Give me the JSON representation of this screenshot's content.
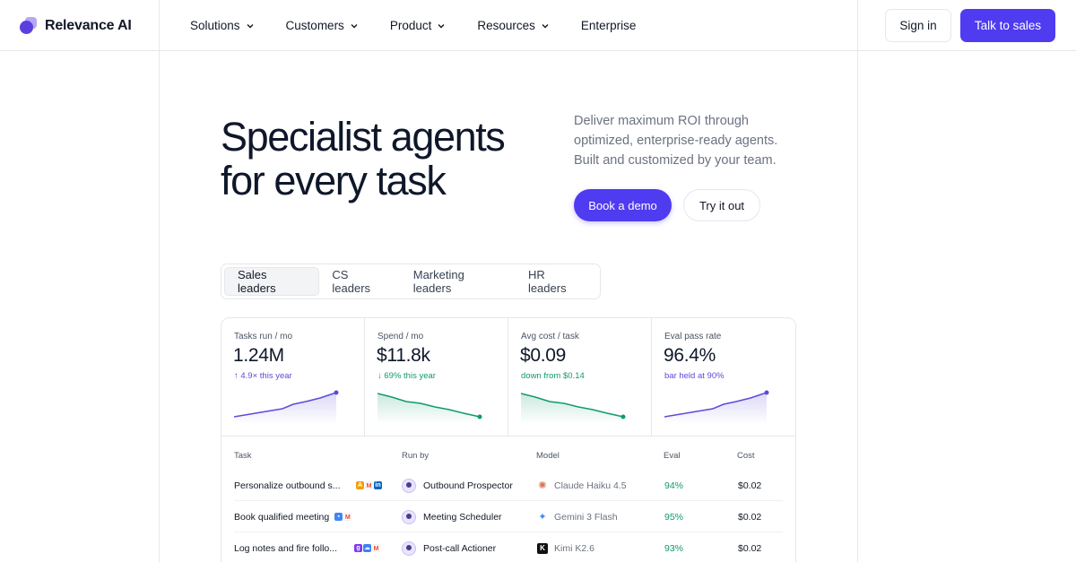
{
  "brand": {
    "name": "Relevance AI"
  },
  "nav": {
    "items": [
      {
        "label": "Solutions",
        "has_menu": true
      },
      {
        "label": "Customers",
        "has_menu": true
      },
      {
        "label": "Product",
        "has_menu": true
      },
      {
        "label": "Resources",
        "has_menu": true
      },
      {
        "label": "Enterprise",
        "has_menu": false
      }
    ],
    "sign_in": "Sign in",
    "talk_to_sales": "Talk to sales"
  },
  "hero": {
    "title_line1": "Specialist agents",
    "title_line2": "for every task",
    "subtitle": "Deliver maximum ROI through optimized, enterprise-ready agents. Built and customized by your team.",
    "book_demo": "Book a demo",
    "try_it": "Try it out"
  },
  "tabs": {
    "items": [
      "Sales leaders",
      "CS leaders",
      "Marketing leaders",
      "HR leaders"
    ],
    "active": "Sales leaders"
  },
  "metrics": [
    {
      "label": "Tasks run / mo",
      "value": "1.24M",
      "delta": "↑ 4.9× this year",
      "trend": "up",
      "color": "#5b4bd8"
    },
    {
      "label": "Spend / mo",
      "value": "$11.8k",
      "delta": "↓ 69% this year",
      "trend": "down",
      "color": "#0f9a6e"
    },
    {
      "label": "Avg cost / task",
      "value": "$0.09",
      "delta": "down from $0.14",
      "trend": "down",
      "color": "#0f9a6e"
    },
    {
      "label": "Eval pass rate",
      "value": "96.4%",
      "delta": "bar held at 90%",
      "trend": "up",
      "color": "#5b4bd8"
    }
  ],
  "table": {
    "headers": {
      "task": "Task",
      "run_by": "Run by",
      "model": "Model",
      "eval": "Eval",
      "cost": "Cost"
    },
    "rows": [
      {
        "task": "Personalize outbound s...",
        "run_by": "Outbound Prospector",
        "model": "Claude Haiku 4.5",
        "model_icon": "claude-icon",
        "eval": "94%",
        "cost": "$0.02"
      },
      {
        "task": "Book qualified meeting",
        "run_by": "Meeting Scheduler",
        "model": "Gemini 3 Flash",
        "model_icon": "gemini-icon",
        "eval": "95%",
        "cost": "$0.02"
      },
      {
        "task": "Log notes and fire follo...",
        "run_by": "Post-call Actioner",
        "model": "Kimi K2.6",
        "model_icon": "kimi-icon",
        "eval": "93%",
        "cost": "$0.02"
      }
    ]
  },
  "colors": {
    "accent": "#4f3bf0",
    "positive": "#0f9a6e",
    "purple_series": "#5b4bd8"
  }
}
